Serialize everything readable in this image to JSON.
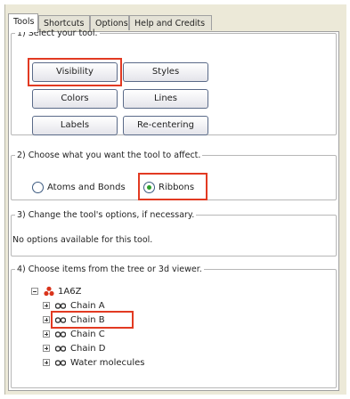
{
  "tabs": [
    {
      "label": "Tools",
      "active": true
    },
    {
      "label": "Shortcuts",
      "active": false
    },
    {
      "label": "Options",
      "active": false
    },
    {
      "label": "Help and Credits",
      "active": false
    }
  ],
  "section1": {
    "legend": "1) Select your tool.",
    "buttons": [
      "Visibility",
      "Styles",
      "Colors",
      "Lines",
      "Labels",
      "Re-centering"
    ],
    "highlighted": "Visibility"
  },
  "section2": {
    "legend": "2) Choose what you want the tool to affect.",
    "options": [
      {
        "label": "Atoms and Bonds",
        "selected": false
      },
      {
        "label": "Ribbons",
        "selected": true
      }
    ]
  },
  "section3": {
    "legend": "3) Change the tool's options, if necessary.",
    "text": "No options available for this tool."
  },
  "section4": {
    "legend": "4) Choose items from the tree or 3d viewer.",
    "tree": {
      "root": "1A6Z",
      "children": [
        "Chain A",
        "Chain B",
        "Chain C",
        "Chain D",
        "Water molecules"
      ],
      "highlighted": "Chain B"
    }
  },
  "colors": {
    "highlight": "#e23a22",
    "radio_selected": "#2ca02c",
    "molecule_icon": "#d9341c"
  }
}
